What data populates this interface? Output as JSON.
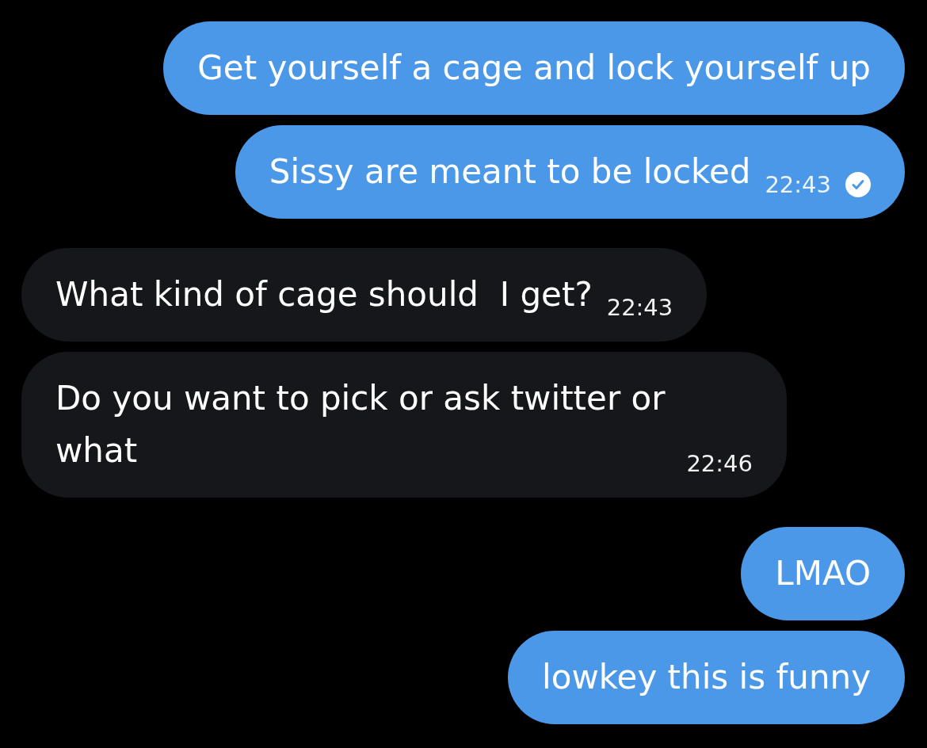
{
  "messages": [
    {
      "kind": "sent",
      "text": "Get yourself a cage and lock yourself up"
    },
    {
      "kind": "sent",
      "text": "Sissy are meant to be locked",
      "time": "22:43",
      "read": true
    },
    {
      "kind": "received",
      "text": "What kind of cage should  I get?",
      "time": "22:43"
    },
    {
      "kind": "received",
      "text": "Do you want to pick or ask twitter or what",
      "time": "22:46"
    },
    {
      "kind": "sent",
      "text": "LMAO"
    },
    {
      "kind": "sent",
      "text": "lowkey this is funny"
    }
  ]
}
